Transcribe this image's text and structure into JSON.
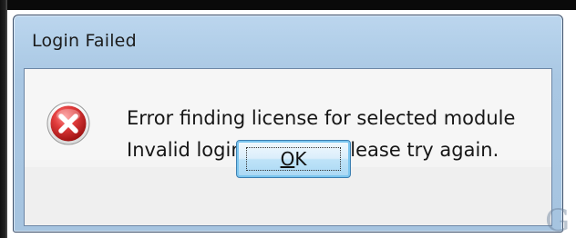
{
  "dialog": {
    "title": "Login Failed",
    "icon": "error-icon",
    "messages": [
      "Error finding license for selected module",
      "Invalid login attempt, please try again."
    ],
    "ok_button": {
      "label": "OK",
      "accelerator": "O"
    }
  },
  "colors": {
    "titlebar": "#b2cfe9",
    "content_background": "#f4f4f4",
    "error_red": "#d12a2a",
    "button_border": "#3c7fb1",
    "button_glow": "#7cc6ef"
  },
  "watermark": {
    "glyph": "G"
  }
}
